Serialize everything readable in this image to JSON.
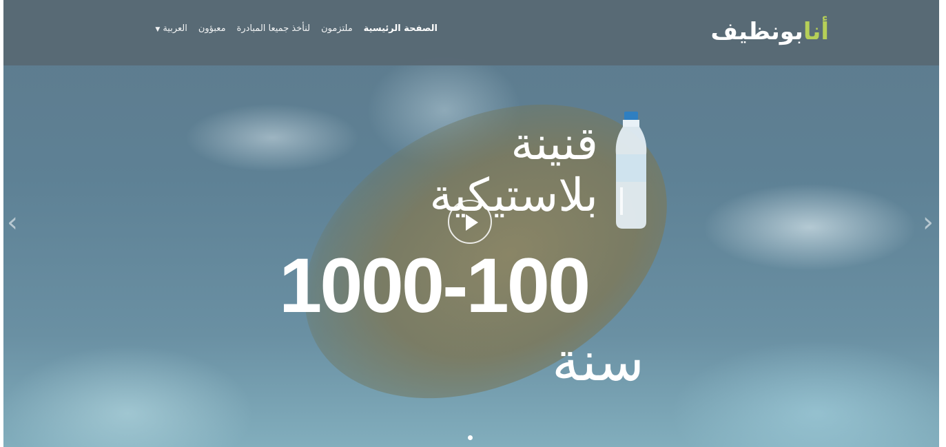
{
  "logo": {
    "part1": "أنا",
    "part2": "بونظيف",
    "accent_color": "#b6cf58"
  },
  "nav": {
    "items": [
      {
        "label": "الصفحة الرئيسية"
      },
      {
        "label": "ملتزمون"
      },
      {
        "label": "لنأخذ جميعا المبادرة"
      },
      {
        "label": "معبؤون"
      },
      {
        "label": "العربية"
      }
    ]
  },
  "slide": {
    "line1": "قنينة",
    "line2": "بلاستيكية",
    "number": "1000-100",
    "unit": "سنة",
    "play_icon": "play-icon",
    "bottle_icon": "bottle-icon"
  },
  "carousel": {
    "prev_arrow": "‹",
    "next_arrow": "›"
  }
}
